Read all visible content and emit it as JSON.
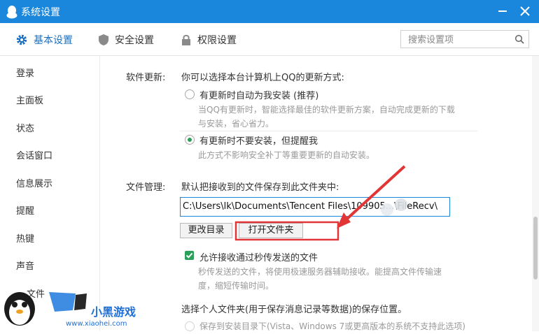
{
  "window": {
    "title": "系统设置"
  },
  "tabs": [
    {
      "label": "基本设置",
      "active": true
    },
    {
      "label": "安全设置",
      "active": false
    },
    {
      "label": "权限设置",
      "active": false
    }
  ],
  "search": {
    "placeholder": "搜索设置项"
  },
  "sidebar": {
    "items": [
      "登录",
      "主面板",
      "状态",
      "会话窗口",
      "信息展示",
      "提醒",
      "热键",
      "声音",
      "文件"
    ]
  },
  "software_update": {
    "label": "软件更新:",
    "prompt": "你可以选择本台计算机上QQ的更新方式:",
    "option1": {
      "label": "有更新时自动为我安装 (推荐)",
      "selected": false,
      "desc_line1": "当QQ有更新时，智能选择最佳的软件更新方案，自动完成更新的下载",
      "desc_line2": "与安装，省心省力。"
    },
    "option2": {
      "label": "有更新时不要安装，但提醒我",
      "selected": true,
      "desc": "此方式不影响安全补丁等重要更新的自动安装。"
    }
  },
  "file_management": {
    "label": "文件管理:",
    "prompt": "默认把接收到的文件保存到此文件夹中:",
    "path": "C:\\Users\\lk\\Documents\\Tencent Files\\109905...\\FileRecv\\",
    "change_button": "更改目录",
    "open_button": "打开文件夹",
    "fast_transfer": {
      "label": "允许接收通过秒传发送的文件",
      "checked": true,
      "desc_line1": "秒传发送的文件，将使用极速服务器辅助接收。能提高文件传输速",
      "desc_line2": "度，缩短传输时间。"
    },
    "personal_folder_prompt": "选择个人文件夹(用于保存消息记录等数据)的保存位置。",
    "personal_option1": "保存到安装目录下(Vista、Windows 7或更高版本的系统不支持此选项)"
  },
  "watermark": {
    "brand": "小黑游戏",
    "url": "www.xiaohei.com"
  },
  "colors": {
    "titlebar": "#1a87dc",
    "accent_green": "#2aa05a",
    "arrow_red": "#e23636"
  }
}
